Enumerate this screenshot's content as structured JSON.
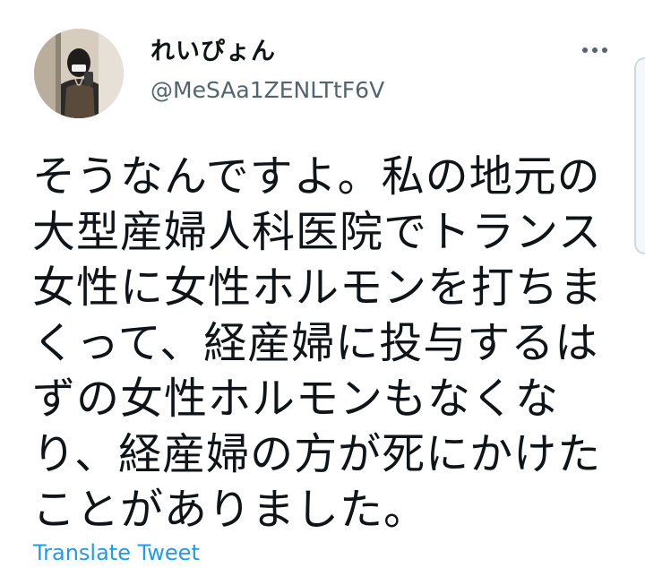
{
  "tweet": {
    "author_name": "れいぴょん",
    "author_handle": "@MeSAa1ZENLTtF6V",
    "more_icon": "more-horizontal-icon",
    "text_lines": [
      "そうなんですよ。私の地元の",
      "大型産婦人科医院でトランス",
      "女性に女性ホルモンを打ちま",
      "くって、経産婦に投与するは",
      "ずの女性ホルモンもなくな",
      "り、経産婦の方が死にかけた",
      "ことがありました。"
    ],
    "translate_label": "Translate Tweet"
  },
  "colors": {
    "text": "#0f1419",
    "secondary": "#536471",
    "link": "#1d9bf0"
  }
}
